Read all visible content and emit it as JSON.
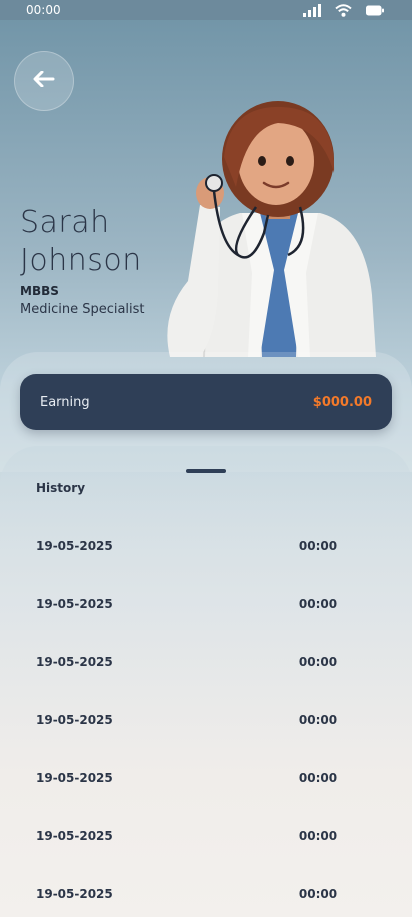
{
  "status_bar": {
    "time": "00:00"
  },
  "doctor": {
    "first_name": "Sarah",
    "last_name": "Johnson",
    "degree": "MBBS",
    "specialty": "Medicine Specialist"
  },
  "earning": {
    "label": "Earning",
    "value": "$000.00",
    "value_color": "#f47a2a"
  },
  "history": {
    "title": "History",
    "rows": [
      {
        "date": "19-05-2025",
        "time": "00:00"
      },
      {
        "date": "19-05-2025",
        "time": "00:00"
      },
      {
        "date": "19-05-2025",
        "time": "00:00"
      },
      {
        "date": "19-05-2025",
        "time": "00:00"
      },
      {
        "date": "19-05-2025",
        "time": "00:00"
      },
      {
        "date": "19-05-2025",
        "time": "00:00"
      },
      {
        "date": "19-05-2025",
        "time": "00:00"
      }
    ]
  },
  "icons": {
    "back": "arrow-left-icon",
    "signal": "signal-icon",
    "wifi": "wifi-icon",
    "battery": "battery-icon"
  },
  "colors": {
    "accent": "#f47a2a",
    "card": "#2f3f57"
  }
}
